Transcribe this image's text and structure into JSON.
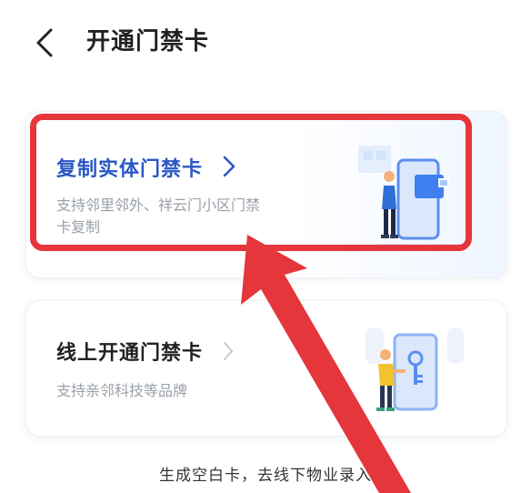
{
  "header": {
    "title": "开通门禁卡"
  },
  "cards": [
    {
      "title": "复制实体门禁卡",
      "desc_line1": "支持邻里邻外、祥云门小区门禁",
      "desc_line2": "卡复制"
    },
    {
      "title": "线上开通门禁卡",
      "desc": "支持亲邻科技等品牌"
    }
  ],
  "bottom": {
    "text": "生成空白卡，去线下物业录入"
  },
  "colors": {
    "accent_blue": "#2a57c4",
    "highlight_red": "#e5363c"
  },
  "icons": [
    "back-chevron-icon",
    "chevron-right-icon",
    "person-phone-card-illustration",
    "person-phone-key-illustration"
  ]
}
